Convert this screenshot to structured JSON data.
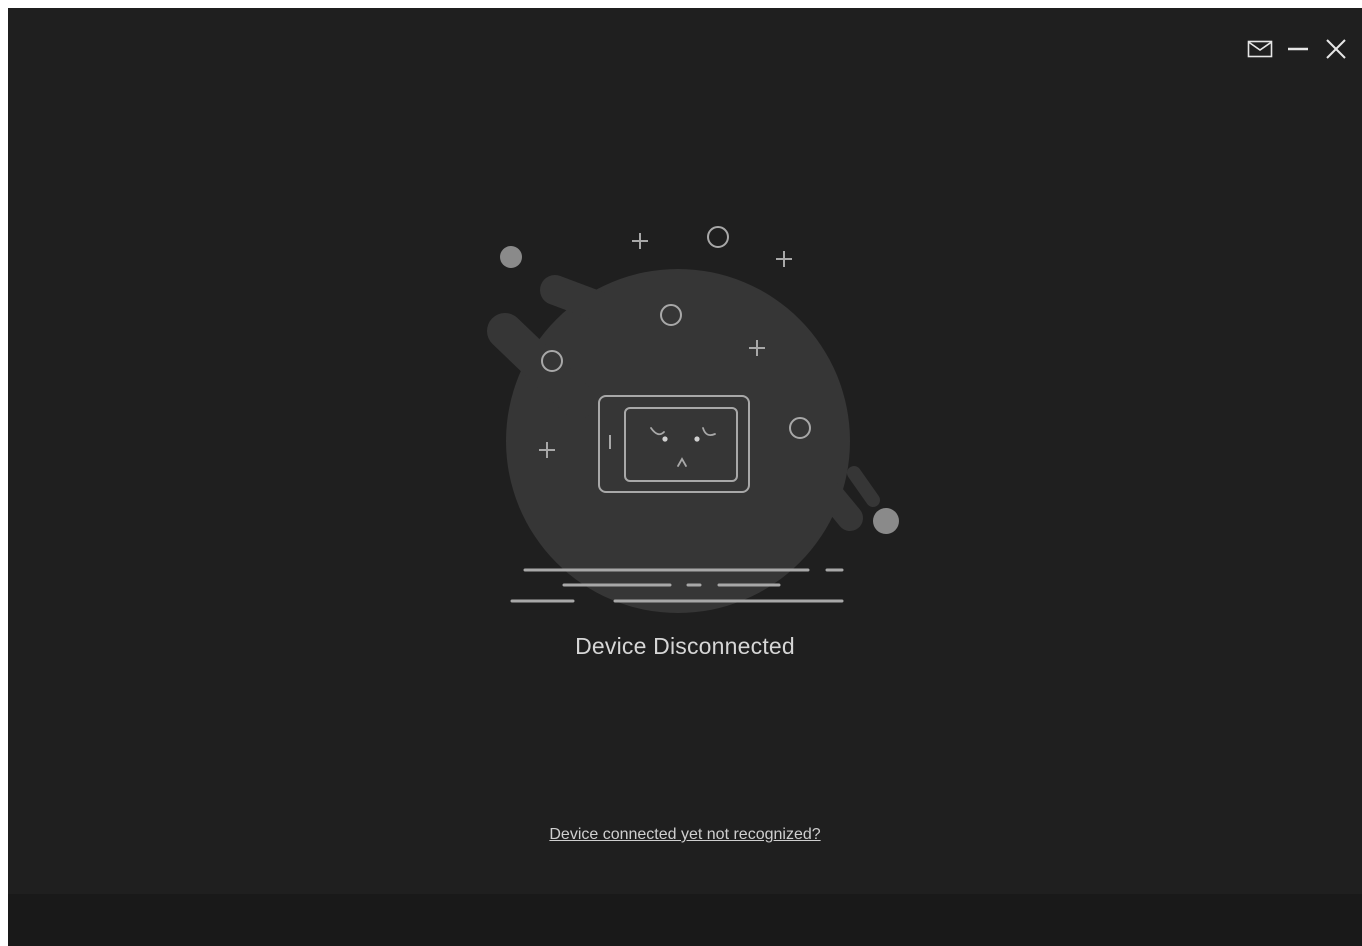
{
  "window": {
    "background": "#1f1f1f",
    "footer_background": "#191919"
  },
  "title_controls": {
    "icons": [
      "mail-icon",
      "minimize-icon",
      "close-icon"
    ]
  },
  "main": {
    "status_text": "Device Disconnected",
    "help_link_text": "Device connected yet not recognized?"
  },
  "colors": {
    "text_primary": "#d6d6d6",
    "illustration_fill": "#363636",
    "illustration_line": "#a8a8a8"
  }
}
